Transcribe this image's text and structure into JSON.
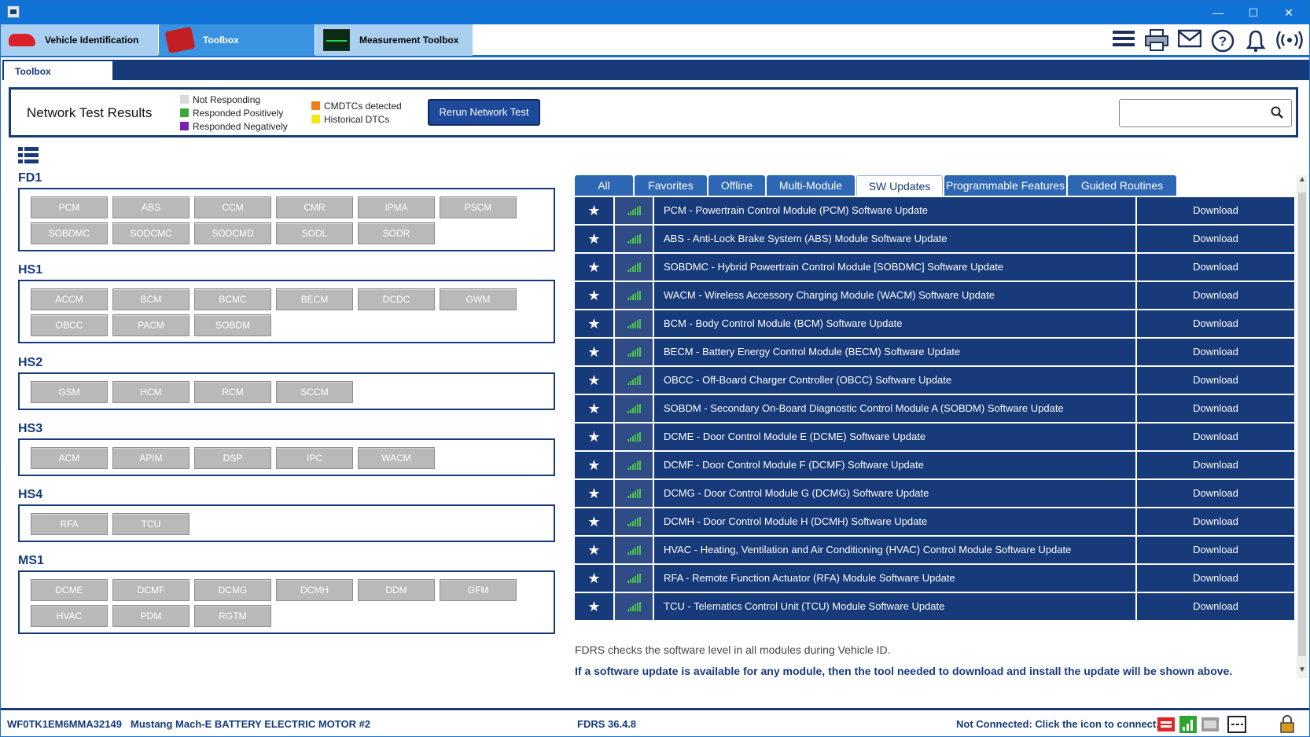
{
  "window": {
    "minimize": "—",
    "maximize": "☐",
    "close": "✕"
  },
  "main_tabs": [
    {
      "label": "Vehicle Identification"
    },
    {
      "label": "Toolbox"
    },
    {
      "label": "Measurement Toolbox"
    }
  ],
  "top_icons": [
    "menu-icon",
    "printer-icon",
    "mail-icon",
    "help-icon",
    "bell-icon",
    "wireless-icon"
  ],
  "subtab": {
    "label": "Toolbox"
  },
  "network_panel": {
    "title": "Network Test Results",
    "legend": [
      {
        "label": "Not Responding",
        "color": "#d9d9d9"
      },
      {
        "label": "Responded Positively",
        "color": "#3aa83a"
      },
      {
        "label": "Responded Negatively",
        "color": "#7a1fb4"
      },
      {
        "label": "CMDTCs detected",
        "color": "#f07c1a"
      },
      {
        "label": "Historical DTCs",
        "color": "#f5e71a"
      }
    ],
    "rerun_label": "Rerun Network Test",
    "search_value": ""
  },
  "networks": [
    {
      "name": "FD1",
      "modules": [
        "PCM",
        "ABS",
        "CCM",
        "CMR",
        "IPMA",
        "PSCM",
        "SOBDMC",
        "SODCMC",
        "SODCMD",
        "SODL",
        "SODR"
      ]
    },
    {
      "name": "HS1",
      "modules": [
        "ACCM",
        "BCM",
        "BCMC",
        "BECM",
        "DCDC",
        "GWM",
        "OBCC",
        "PACM",
        "SOBDM"
      ]
    },
    {
      "name": "HS2",
      "modules": [
        "GSM",
        "HCM",
        "RCM",
        "SCCM"
      ]
    },
    {
      "name": "HS3",
      "modules": [
        "ACM",
        "APIM",
        "DSP",
        "IPC",
        "WACM"
      ]
    },
    {
      "name": "HS4",
      "modules": [
        "RFA",
        "TCU"
      ]
    },
    {
      "name": "MS1",
      "modules": [
        "DCME",
        "DCMF",
        "DCMG",
        "DCMH",
        "DDM",
        "GFM",
        "HVAC",
        "PDM",
        "RGTM"
      ]
    }
  ],
  "right_tabs": [
    {
      "label": "All",
      "active": false
    },
    {
      "label": "Favorites",
      "active": false
    },
    {
      "label": "Offline",
      "active": false
    },
    {
      "label": "Multi-Module",
      "active": false
    },
    {
      "label": "SW Updates",
      "active": true
    },
    {
      "label": "Programmable Features",
      "active": false
    },
    {
      "label": "Guided Routines",
      "active": false
    }
  ],
  "updates": [
    {
      "desc": "PCM - Powertrain Control Module (PCM) Software Update",
      "action": "Download"
    },
    {
      "desc": "ABS - Anti-Lock Brake System (ABS) Module Software Update",
      "action": "Download"
    },
    {
      "desc": "SOBDMC - Hybrid Powertrain Control Module [SOBDMC] Software Update",
      "action": "Download"
    },
    {
      "desc": "WACM - Wireless Accessory Charging Module (WACM) Software Update",
      "action": "Download"
    },
    {
      "desc": "BCM - Body Control Module (BCM) Software Update",
      "action": "Download"
    },
    {
      "desc": "BECM - Battery Energy Control Module (BECM) Software Update",
      "action": "Download"
    },
    {
      "desc": "OBCC - Off-Board Charger Controller (OBCC) Software Update",
      "action": "Download"
    },
    {
      "desc": "SOBDM - Secondary On-Board Diagnostic Control Module A (SOBDM) Software Update",
      "action": "Download"
    },
    {
      "desc": "DCME - Door Control Module E (DCME) Software Update",
      "action": "Download"
    },
    {
      "desc": "DCMF - Door Control Module F (DCMF) Software Update",
      "action": "Download"
    },
    {
      "desc": "DCMG - Door Control Module G (DCMG) Software Update",
      "action": "Download"
    },
    {
      "desc": "DCMH - Door Control Module H (DCMH) Software Update",
      "action": "Download"
    },
    {
      "desc": "HVAC - Heating, Ventilation and Air Conditioning (HVAC) Control Module Software Update",
      "action": "Download"
    },
    {
      "desc": "RFA - Remote Function Actuator (RFA) Module Software Update",
      "action": "Download"
    },
    {
      "desc": "TCU - Telematics Control Unit (TCU) Module Software Update",
      "action": "Download"
    }
  ],
  "notes": {
    "line1": "FDRS checks the software level in all modules during Vehicle ID.",
    "line2": "If a software update is available for any module, then the tool needed to download and install the update will be shown above."
  },
  "status": {
    "vin": "WF0TK1EM6MMA32149",
    "model": "Mustang Mach-E BATTERY ELECTRIC MOTOR #2",
    "version": "FDRS 36.4.8",
    "connection": "Not Connected: Click the icon to connect."
  }
}
